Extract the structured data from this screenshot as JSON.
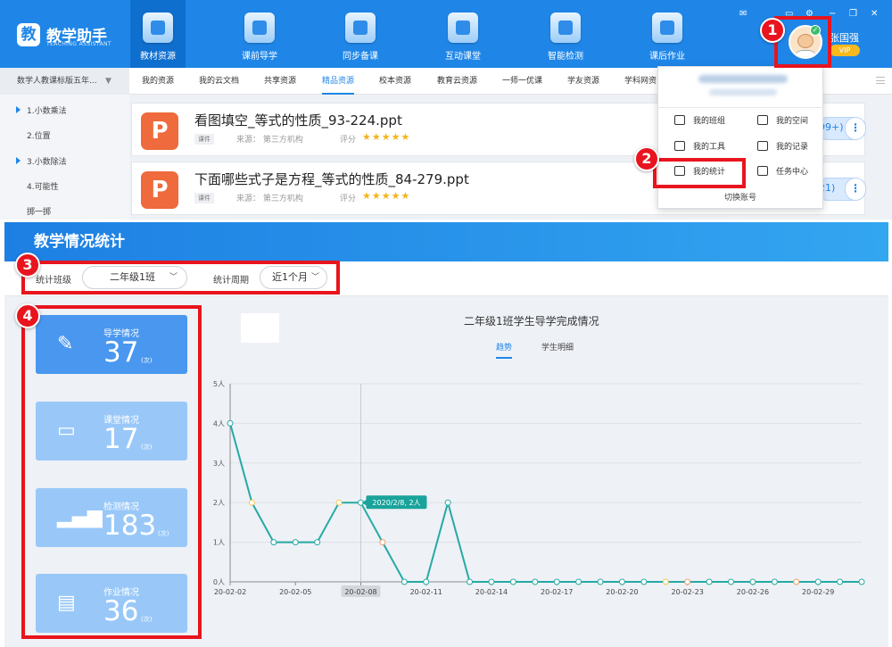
{
  "app": {
    "name": "教学助手",
    "logo_char": "教",
    "subtitle": "TEACHING ASSISTANT"
  },
  "nav": [
    {
      "label": "教材资源",
      "active": true
    },
    {
      "label": "课前导学",
      "active": false
    },
    {
      "label": "同步备课",
      "active": false
    },
    {
      "label": "互动课堂",
      "active": false
    },
    {
      "label": "智能检测",
      "active": false
    },
    {
      "label": "课后作业",
      "active": false
    }
  ],
  "user": {
    "name": "张国强",
    "vip": "VIP"
  },
  "book_selector": "数学人教课标版五年...",
  "subtabs": [
    {
      "label": "我的资源",
      "active": false
    },
    {
      "label": "我的云文档",
      "active": false
    },
    {
      "label": "共享资源",
      "active": false
    },
    {
      "label": "精品资源",
      "active": true
    },
    {
      "label": "校本资源",
      "active": false
    },
    {
      "label": "教育云资源",
      "active": false
    },
    {
      "label": "一师一优课",
      "active": false
    },
    {
      "label": "学友资源",
      "active": false
    },
    {
      "label": "学科网资",
      "active": false
    }
  ],
  "outline": [
    {
      "label": "1.小数乘法",
      "expandable": true
    },
    {
      "label": "2.位置",
      "expandable": false
    },
    {
      "label": "3.小数除法",
      "expandable": true
    },
    {
      "label": "4.可能性",
      "expandable": false
    },
    {
      "label": "掷一掷",
      "expandable": false
    }
  ],
  "resources": [
    {
      "icon_text": "P",
      "title": "看图填空_等式的性质_93-224.ppt",
      "tag": "课件",
      "source": "来源： 第三方机构",
      "rating_label": "评分",
      "stars": "★★★★★",
      "count": "99+)"
    },
    {
      "icon_text": "P",
      "title": "下面哪些式子是方程_等式的性质_84-279.ppt",
      "tag": "课件",
      "source": "来源： 第三方机构",
      "rating_label": "评分",
      "stars": "★★★★★",
      "count": "21)"
    }
  ],
  "dropdown": {
    "items": [
      {
        "label": "我的班组",
        "icon": "group-icon"
      },
      {
        "label": "我的空间",
        "icon": "space-icon"
      },
      {
        "label": "我的工具",
        "icon": "tool-icon"
      },
      {
        "label": "我的记录",
        "icon": "record-icon"
      },
      {
        "label": "我的统计",
        "icon": "statistics-icon"
      },
      {
        "label": "任务中心",
        "icon": "task-icon"
      }
    ],
    "switch_account": "切换账号"
  },
  "annotations": [
    "1",
    "2",
    "3",
    "4"
  ],
  "stats_page": {
    "title": "教学情况统计",
    "class_label": "统计班级",
    "class_value": "二年级1班",
    "period_label": "统计周期",
    "period_value": "近1个月",
    "cards": [
      {
        "label": "导学情况",
        "value": "37",
        "unit": "(次)",
        "icon": "pencil-icon",
        "active": true
      },
      {
        "label": "课堂情况",
        "value": "17",
        "unit": "(次)",
        "icon": "monitor-icon",
        "active": false
      },
      {
        "label": "检测情况",
        "value": "183",
        "unit": "(次)",
        "icon": "chart-icon",
        "active": false
      },
      {
        "label": "作业情况",
        "value": "36",
        "unit": "(次)",
        "icon": "notebook-icon",
        "active": false
      }
    ],
    "chart_title": "二年级1班学生导学完成情况",
    "chart_tabs": [
      {
        "label": "趋势",
        "active": true
      },
      {
        "label": "学生明细",
        "active": false
      }
    ]
  },
  "colors": {
    "brand_blue": "#1f86e8",
    "line": "#25aaa4",
    "annotation_red": "#e8141e",
    "star": "#f3b418"
  },
  "chart_data": {
    "type": "line",
    "title": "二年级1班学生导学完成情况",
    "ylim": [
      0,
      5
    ],
    "y_ticks": [
      "0人",
      "1人",
      "2人",
      "3人",
      "4人",
      "5人"
    ],
    "x": [
      "20-02-02",
      "20-02-03",
      "20-02-04",
      "20-02-05",
      "20-02-06",
      "20-02-07",
      "20-02-08",
      "20-02-09",
      "20-02-10",
      "20-02-11",
      "20-02-12",
      "20-02-13",
      "20-02-14",
      "20-02-15",
      "20-02-16",
      "20-02-17",
      "20-02-18",
      "20-02-19",
      "20-02-20",
      "20-02-21",
      "20-02-22",
      "20-02-23",
      "20-02-24",
      "20-02-25",
      "20-02-26",
      "20-02-27",
      "20-02-28",
      "20-02-29",
      "20-03-01",
      "20-03-02"
    ],
    "x_tick_labels": [
      "20-02-02",
      "20-02-05",
      "20-02-08",
      "20-02-11",
      "20-02-14",
      "20-02-17",
      "20-02-20",
      "20-02-23",
      "20-02-26",
      "20-02-29"
    ],
    "series": [
      {
        "values": [
          4,
          2,
          1,
          1,
          1,
          2,
          2,
          1,
          0,
          0,
          2,
          0,
          0,
          0,
          0,
          0,
          0,
          0,
          0,
          0,
          0,
          0,
          0,
          0,
          0,
          0,
          0,
          0,
          0,
          0
        ]
      }
    ],
    "tooltip": {
      "text": "2020/2/8, 2人",
      "index": 6
    },
    "highlight_x": "20-02-08",
    "grid": true
  }
}
